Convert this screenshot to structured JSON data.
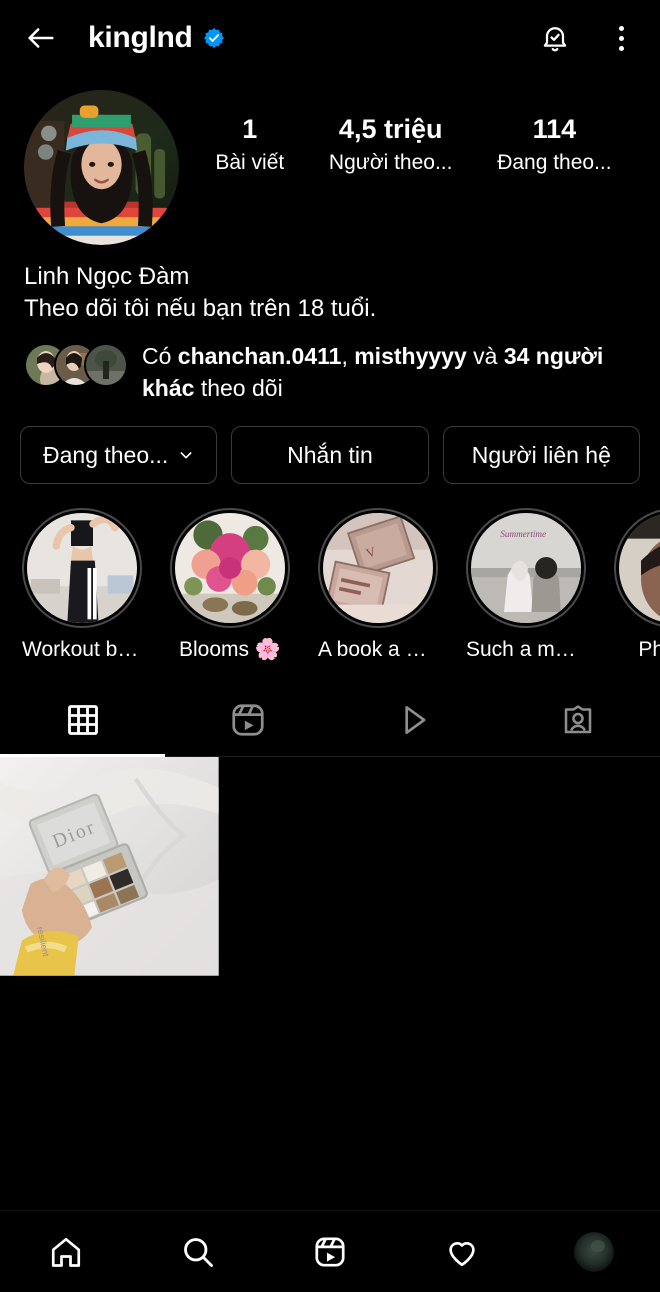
{
  "header": {
    "username": "kinglnd",
    "back_icon": "back-arrow-icon",
    "verified_icon": "verified-badge-icon",
    "bell_icon": "notification-bell-icon",
    "menu_icon": "more-options-icon",
    "verified_color": "#0095F6"
  },
  "profile": {
    "avatar_name": "profile-picture",
    "stats": [
      {
        "value": "1",
        "label": "Bài viết"
      },
      {
        "value": "4,5 triệu",
        "label": "Người theo..."
      },
      {
        "value": "114",
        "label": "Đang theo..."
      }
    ],
    "display_name": "Linh Ngọc Đàm",
    "bio_text": "Theo dõi tôi nếu bạn trên 18 tuổi.",
    "mutuals": {
      "prefix": "Có ",
      "name1": "chanchan.0411",
      "separator": ", ",
      "name2": "misthyyyy",
      "middle": " và ",
      "others": "34 người khác",
      "suffix": " theo dõi"
    }
  },
  "actions": [
    {
      "label": "Đang theo...",
      "has_chevron": true,
      "name": "following-button"
    },
    {
      "label": "Nhắn tin",
      "has_chevron": false,
      "name": "message-button"
    },
    {
      "label": "Người liên hệ",
      "has_chevron": false,
      "name": "contact-button"
    }
  ],
  "highlights": [
    {
      "label": "Workout bae ...",
      "image": "workout-photo"
    },
    {
      "label": "Blooms 🌸",
      "image": "flowers-photo"
    },
    {
      "label": "A book a day",
      "image": "books-photo"
    },
    {
      "label": "Such a mood",
      "image": "beach-photo"
    },
    {
      "label": "Phú Qu",
      "image": "portrait-photo"
    }
  ],
  "tabs": [
    {
      "name": "tab-grid",
      "icon": "grid-icon",
      "active": true
    },
    {
      "name": "tab-reels",
      "icon": "reels-icon",
      "active": false
    },
    {
      "name": "tab-igtv",
      "icon": "play-icon",
      "active": false
    },
    {
      "name": "tab-tagged",
      "icon": "tagged-person-icon",
      "active": false
    }
  ],
  "posts": [
    {
      "name": "post-dior-palette",
      "filled": true
    },
    {
      "name": "post-empty-1",
      "filled": false
    },
    {
      "name": "post-empty-2",
      "filled": false
    }
  ],
  "bottom_nav": [
    {
      "name": "nav-home",
      "icon": "home-icon"
    },
    {
      "name": "nav-search",
      "icon": "search-icon"
    },
    {
      "name": "nav-reels",
      "icon": "reels-icon"
    },
    {
      "name": "nav-activity",
      "icon": "heart-icon"
    },
    {
      "name": "nav-profile",
      "icon": "profile-avatar-icon"
    }
  ]
}
